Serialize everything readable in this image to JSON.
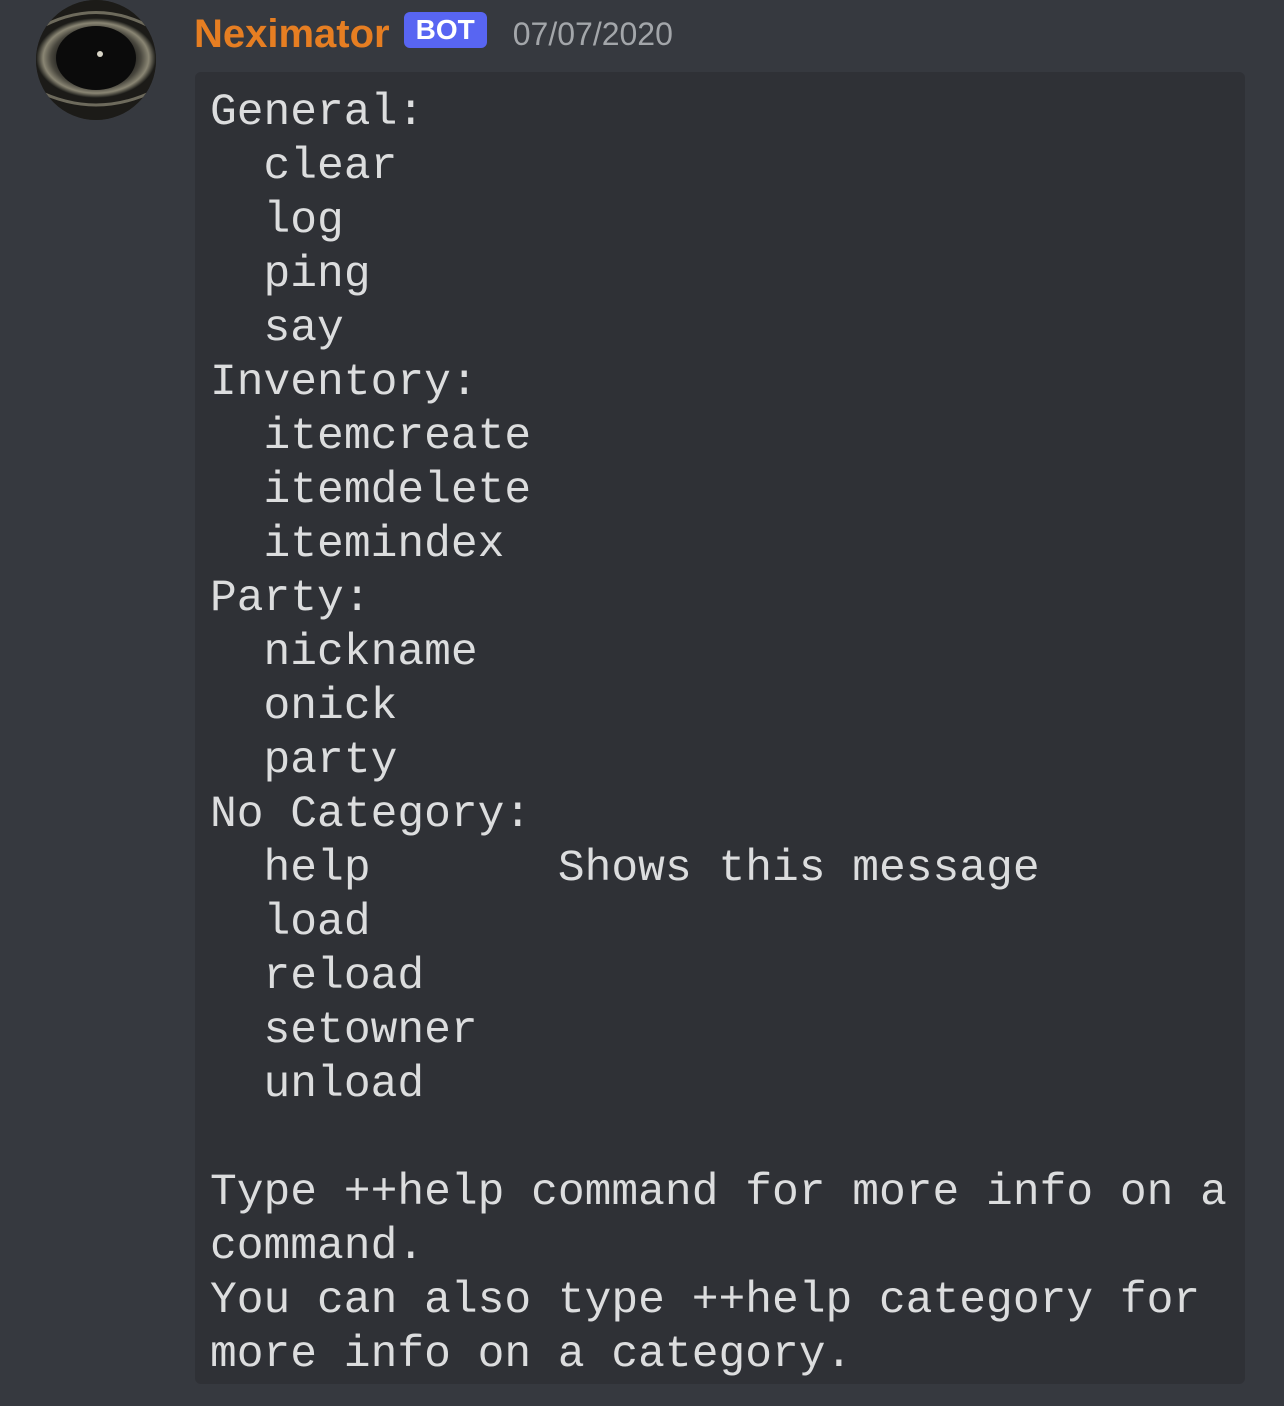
{
  "message": {
    "username": "Neximator",
    "bot_tag": "BOT",
    "timestamp": "07/07/2020",
    "avatar_icon": "eye-avatar",
    "username_color": "#e67e22",
    "bot_tag_color": "#5865f2",
    "content": "General:\n  clear\n  log\n  ping\n  say\nInventory:\n  itemcreate\n  itemdelete\n  itemindex\nParty:\n  nickname\n  onick\n  party\nNo Category:\n  help       Shows this message\n  load\n  reload\n  setowner\n  unload\n\nType ++help command for more info on a command.\nYou can also type ++help category for more info on a category."
  }
}
